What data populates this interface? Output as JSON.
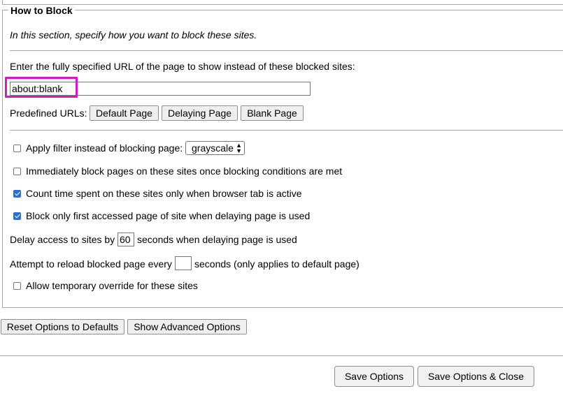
{
  "section": {
    "legend": "How to Block",
    "intro": "In this section, specify how you want to block these sites."
  },
  "block_url": {
    "label": "Enter the fully specified URL of the page to show instead of these blocked sites:",
    "value": "about:blank",
    "predefined_label": "Predefined URLs:",
    "buttons": [
      "Default Page",
      "Delaying Page",
      "Blank Page"
    ]
  },
  "options": {
    "apply_filter": {
      "label": "Apply filter instead of blocking page:",
      "checked": false,
      "filter_value": "grayscale"
    },
    "immediately_block": {
      "label": "Immediately block pages on these sites once blocking conditions are met",
      "checked": false
    },
    "count_active_tab": {
      "label": "Count time spent on these sites only when browser tab is active",
      "checked": true
    },
    "block_first_page": {
      "label": "Block only first accessed page of site when delaying page is used",
      "checked": true
    },
    "delay": {
      "prefix": "Delay access to sites by",
      "value": "60",
      "suffix": "seconds when delaying page is used"
    },
    "reload": {
      "prefix": "Attempt to reload blocked page every",
      "value": "",
      "suffix": "seconds (only applies to default page)"
    },
    "allow_override": {
      "label": "Allow temporary override for these sites",
      "checked": false
    }
  },
  "footer": {
    "reset_label": "Reset Options to Defaults",
    "advanced_label": "Show Advanced Options",
    "save_label": "Save Options",
    "save_close_label": "Save Options & Close"
  }
}
